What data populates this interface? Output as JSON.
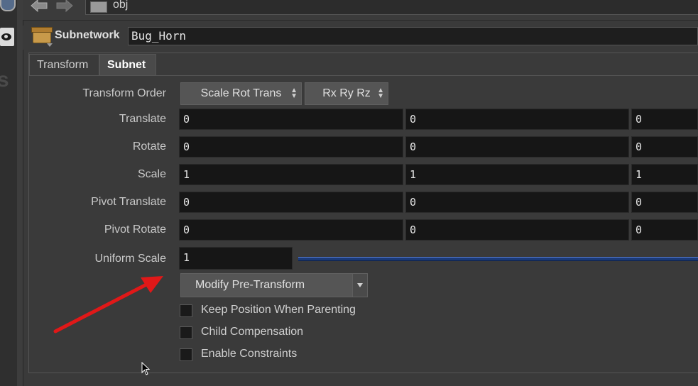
{
  "path": {
    "network": "obj"
  },
  "header": {
    "node_type": "Subnetwork",
    "node_name": "Bug_Horn"
  },
  "tabs": [
    {
      "label": "Transform",
      "active": false
    },
    {
      "label": "Subnet",
      "active": true
    }
  ],
  "params": {
    "transform_order": {
      "label": "Transform Order",
      "order": "Scale Rot Trans",
      "rotation_order": "Rx Ry Rz"
    },
    "translate": {
      "label": "Translate",
      "values": [
        "0",
        "0",
        "0"
      ]
    },
    "rotate": {
      "label": "Rotate",
      "values": [
        "0",
        "0",
        "0"
      ]
    },
    "scale": {
      "label": "Scale",
      "values": [
        "1",
        "1",
        "1"
      ]
    },
    "pivot_translate": {
      "label": "Pivot Translate",
      "values": [
        "0",
        "0",
        "0"
      ]
    },
    "pivot_rotate": {
      "label": "Pivot Rotate",
      "values": [
        "0",
        "0",
        "0"
      ]
    },
    "uniform_scale": {
      "label": "Uniform Scale",
      "value": "1"
    },
    "pre_transform_menu": "Modify Pre-Transform",
    "checkboxes": [
      {
        "label": "Keep Position When Parenting",
        "checked": false
      },
      {
        "label": "Child Compensation",
        "checked": false
      },
      {
        "label": "Enable Constraints",
        "checked": false
      }
    ]
  },
  "icons": {
    "back": "arrow-left-icon",
    "forward": "arrow-right-icon",
    "network": "network-icon",
    "display": "eye-icon",
    "node": "subnetwork-box-icon"
  },
  "colors": {
    "background": "#3a3a3a",
    "field": "#161616",
    "slider": "#1b3a78",
    "annotation_arrow": "#e01818"
  }
}
